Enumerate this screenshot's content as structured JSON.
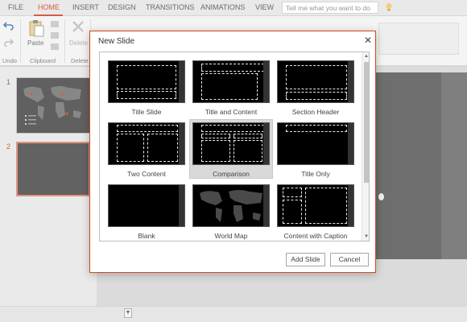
{
  "ribbon": {
    "tabs": [
      "FILE",
      "HOME",
      "INSERT",
      "DESIGN",
      "TRANSITIONS",
      "ANIMATIONS",
      "VIEW"
    ],
    "active_tab": "HOME",
    "tell_me_placeholder": "Tell me what you want to do",
    "paste_label": "Paste",
    "delete_label": "Delete",
    "groups": [
      "Undo",
      "Clipboard",
      "Delete"
    ]
  },
  "slides_pane": {
    "numbers": [
      "1",
      "2"
    ],
    "selected": "2"
  },
  "dialog": {
    "title": "New Slide",
    "layouts": [
      {
        "name": "Title Slide"
      },
      {
        "name": "Title and Content"
      },
      {
        "name": "Section Header"
      },
      {
        "name": "Two Content"
      },
      {
        "name": "Comparison",
        "selected": true
      },
      {
        "name": "Title Only"
      },
      {
        "name": "Blank"
      },
      {
        "name": "World Map"
      },
      {
        "name": "Content with Caption"
      }
    ],
    "add_button": "Add Slide",
    "cancel_button": "Cancel"
  },
  "colors": {
    "accent": "#d24726",
    "ribbon_bg": "#f3f3f3",
    "slide_bg": "#000000"
  },
  "icons": [
    "undo-icon",
    "redo-icon",
    "paste-icon",
    "delete-icon",
    "lightbulb-icon",
    "close-icon",
    "scroll-up-icon",
    "scroll-down-icon"
  ]
}
